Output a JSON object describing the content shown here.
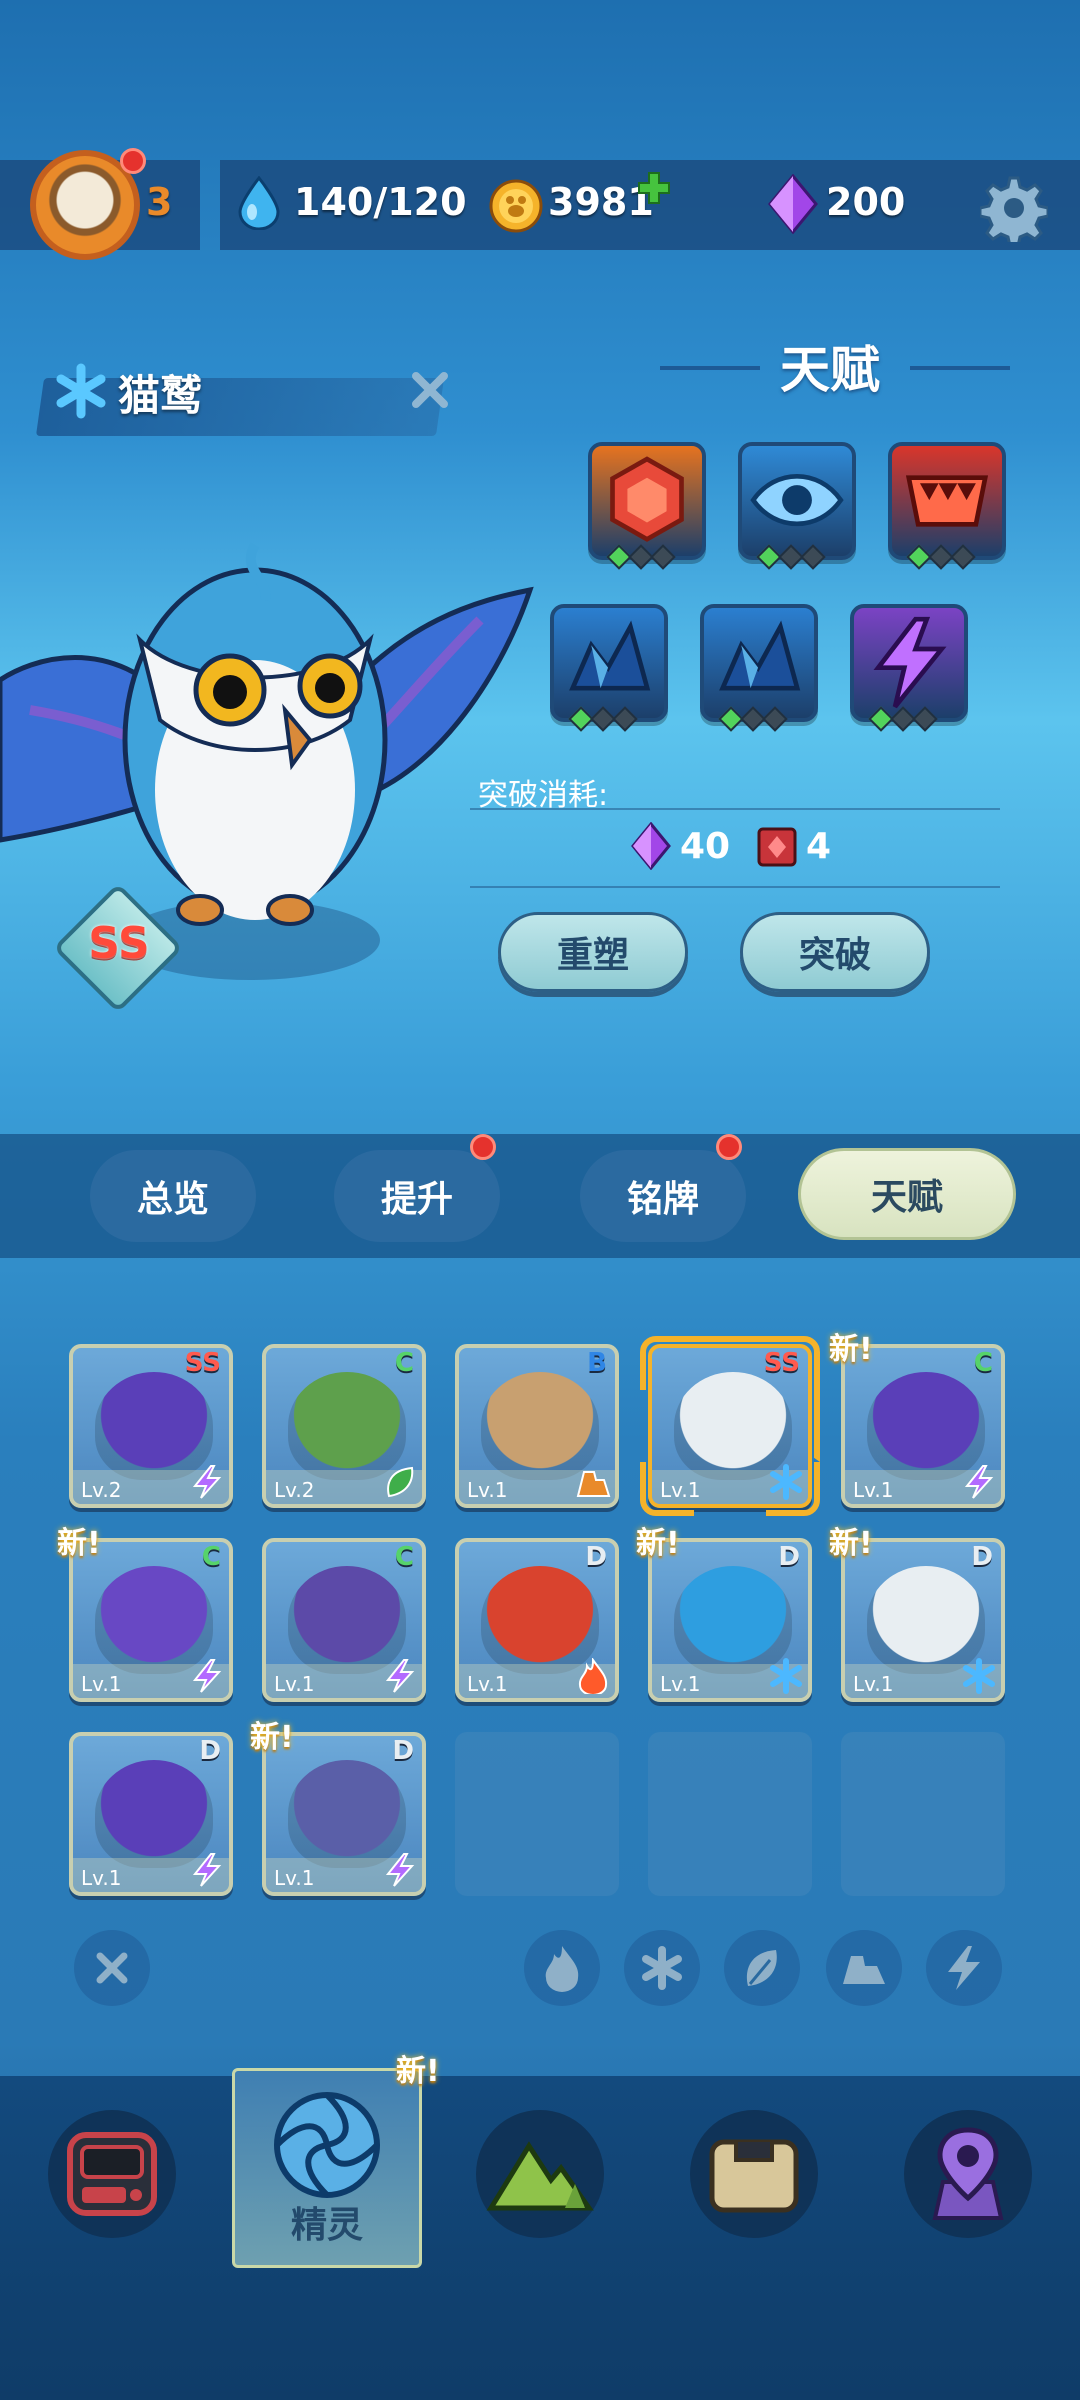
{
  "topbar": {
    "level": "3",
    "water": "140/120",
    "coins": "3981",
    "gems": "200"
  },
  "creature": {
    "name": "猫鹫",
    "rank": "SS"
  },
  "talent": {
    "title": "天赋",
    "icons": [
      {
        "name": "hexagon-gem-icon",
        "color": "#e6731f",
        "pips_on": 1
      },
      {
        "name": "eye-icon",
        "color": "#2f8ad6",
        "pips_on": 1
      },
      {
        "name": "fangs-icon",
        "color": "#d9362b",
        "pips_on": 1
      },
      {
        "name": "ice-shard-icon",
        "color": "#2b7fd0",
        "pips_on": 1
      },
      {
        "name": "ice-shard-icon",
        "color": "#2b7fd0",
        "pips_on": 1
      },
      {
        "name": "lightning-icon",
        "color": "#7b43c4",
        "pips_on": 1
      }
    ],
    "cost_label": "突破消耗:",
    "cost_gem": "40",
    "cost_book": "4",
    "reforge_label": "重塑",
    "breakthrough_label": "突破"
  },
  "tabs": [
    {
      "label": "总览",
      "dot": false
    },
    {
      "label": "提升",
      "dot": true
    },
    {
      "label": "铭牌",
      "dot": true
    },
    {
      "label": "天赋",
      "dot": false
    }
  ],
  "new_tag": "新!",
  "cards": [
    {
      "lv": "Lv.2",
      "grade": "SS",
      "element": "lightning",
      "color": "#5a3fb8",
      "new": false,
      "selected": false
    },
    {
      "lv": "Lv.2",
      "grade": "C",
      "element": "grass",
      "color": "#5ea04c",
      "new": false,
      "selected": false
    },
    {
      "lv": "Lv.1",
      "grade": "B",
      "element": "earth",
      "color": "#c8a070",
      "new": false,
      "selected": false
    },
    {
      "lv": "Lv.1",
      "grade": "SS",
      "element": "ice",
      "color": "#e8eef2",
      "new": false,
      "selected": true
    },
    {
      "lv": "Lv.1",
      "grade": "C",
      "element": "lightning",
      "color": "#5a3fb8",
      "new": true,
      "selected": false
    },
    {
      "lv": "Lv.1",
      "grade": "C",
      "element": "lightning",
      "color": "#6848c4",
      "new": true,
      "selected": false
    },
    {
      "lv": "Lv.1",
      "grade": "C",
      "element": "lightning",
      "color": "#5c4aa8",
      "new": false,
      "selected": false
    },
    {
      "lv": "Lv.1",
      "grade": "D",
      "element": "fire",
      "color": "#d9432e",
      "new": false,
      "selected": false
    },
    {
      "lv": "Lv.1",
      "grade": "D",
      "element": "ice",
      "color": "#2e9ee0",
      "new": true,
      "selected": false
    },
    {
      "lv": "Lv.1",
      "grade": "D",
      "element": "ice",
      "color": "#e8eef2",
      "new": true,
      "selected": false
    },
    {
      "lv": "Lv.1",
      "grade": "D",
      "element": "lightning",
      "color": "#5a3fb8",
      "new": false,
      "selected": false
    },
    {
      "lv": "Lv.1",
      "grade": "D",
      "element": "lightning",
      "color": "#5a5fa8",
      "new": true,
      "selected": false
    }
  ],
  "grade_colors": {
    "SS": "#ff5a4e",
    "C": "#56d36a",
    "B": "#2f86e6",
    "D": "#e8eef2"
  },
  "nav": {
    "active_label": "精灵",
    "new_tag": "新!"
  }
}
